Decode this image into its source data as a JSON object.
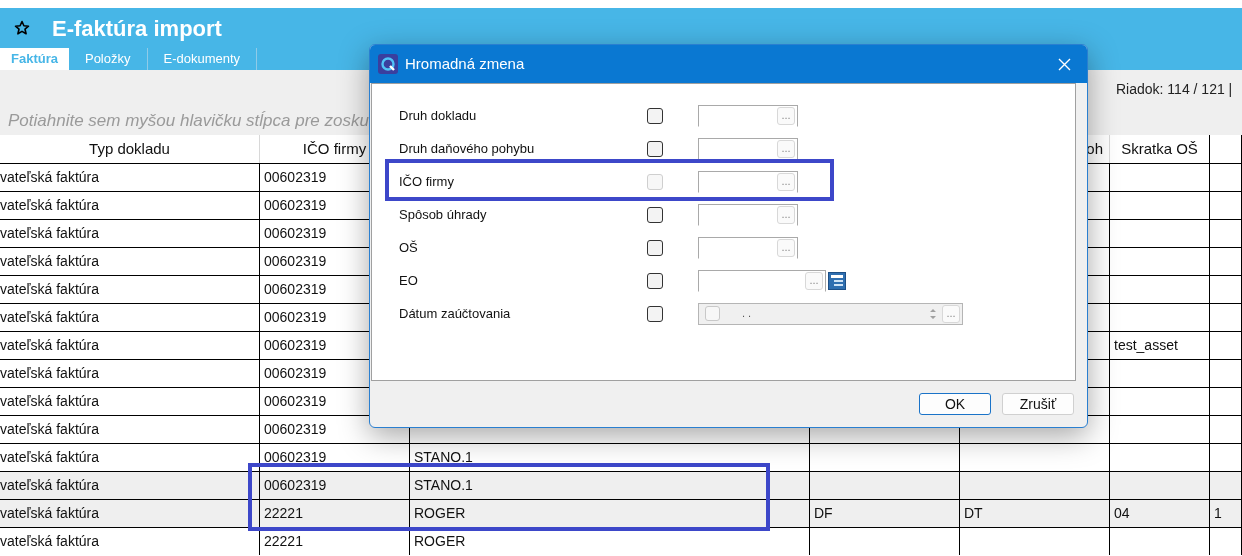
{
  "app": {
    "title": "E-faktúra import"
  },
  "tabs": [
    {
      "label": "Faktúra",
      "selected": true
    },
    {
      "label": "Položky",
      "selected": false
    },
    {
      "label": "E-dokumenty",
      "selected": false
    }
  ],
  "row_counter": "Riadok: 114 / 121 |",
  "group_hint": "Potiahnite sem myšou hlavičku stĺpca pre zosku",
  "table": {
    "header": {
      "column_1": "Typ dokladu",
      "column_2": "IČO firmy",
      "column_5": "oh",
      "column_6": "Skratka OŠ"
    },
    "rows": [
      {
        "cells": {
          "column_1": "vateľská faktúra",
          "column_2": "00602319"
        },
        "shaded": false,
        "outlined": false
      },
      {
        "cells": {
          "column_1": "vateľská faktúra",
          "column_2": "00602319"
        },
        "shaded": false,
        "outlined": false
      },
      {
        "cells": {
          "column_1": "vateľská faktúra",
          "column_2": "00602319"
        },
        "shaded": false,
        "outlined": false
      },
      {
        "cells": {
          "column_1": "vateľská faktúra",
          "column_2": "00602319"
        },
        "shaded": false,
        "outlined": false
      },
      {
        "cells": {
          "column_1": "vateľská faktúra",
          "column_2": "00602319"
        },
        "shaded": false,
        "outlined": false
      },
      {
        "cells": {
          "column_1": "vateľská faktúra",
          "column_2": "00602319"
        },
        "shaded": false,
        "outlined": false
      },
      {
        "cells": {
          "column_1": "vateľská faktúra",
          "column_2": "00602319",
          "column_6": "test_asset"
        },
        "shaded": false,
        "outlined": false
      },
      {
        "cells": {
          "column_1": "vateľská faktúra",
          "column_2": "00602319"
        },
        "shaded": false,
        "outlined": false
      },
      {
        "cells": {
          "column_1": "vateľská faktúra",
          "column_2": "00602319"
        },
        "shaded": false,
        "outlined": false
      },
      {
        "cells": {
          "column_1": "vateľská faktúra",
          "column_2": "00602319"
        },
        "shaded": false,
        "outlined": false
      },
      {
        "cells": {
          "column_1": "vateľská faktúra",
          "column_2": "00602319",
          "column_3": "STANO.1"
        },
        "shaded": false,
        "outlined": false
      },
      {
        "cells": {
          "column_1": "vateľská faktúra",
          "column_2": "00602319",
          "column_3": "STANO.1"
        },
        "shaded": true,
        "outlined": true
      },
      {
        "cells": {
          "column_1": "vateľská faktúra",
          "column_2": "22221",
          "column_3": "ROGER",
          "column_4": "DF",
          "column_5": "DT",
          "column_6": "04",
          "column_7": "1"
        },
        "shaded": true,
        "outlined": true
      },
      {
        "cells": {
          "column_1": "vateľská faktúra",
          "column_2": "22221",
          "column_3": "ROGER"
        },
        "shaded": false,
        "outlined": false
      }
    ]
  },
  "dialog": {
    "title": "Hromadná zmena",
    "fields": [
      {
        "label": "Druh dokladu",
        "kind": "lookup",
        "checked": false,
        "disabled": false,
        "outlined": false,
        "browse": "..."
      },
      {
        "label": "Druh daňového pohybu",
        "kind": "lookup",
        "checked": false,
        "disabled": false,
        "outlined": false,
        "browse": "..."
      },
      {
        "label": "IČO firmy",
        "kind": "lookup",
        "checked": false,
        "disabled": true,
        "outlined": true,
        "browse": "..."
      },
      {
        "label": "Spôsob úhrady",
        "kind": "lookup",
        "checked": false,
        "disabled": false,
        "outlined": false,
        "browse": "..."
      },
      {
        "label": "OŠ",
        "kind": "lookup",
        "checked": false,
        "disabled": false,
        "outlined": false,
        "browse": "..."
      },
      {
        "label": "EO",
        "kind": "lookup_tree",
        "checked": false,
        "disabled": false,
        "outlined": false,
        "browse": "..."
      },
      {
        "label": "Dátum zaúčtovania",
        "kind": "date",
        "checked": false,
        "disabled": false,
        "outlined": false,
        "date_checked": false,
        "mask": ". .",
        "browse": "..."
      }
    ],
    "buttons": [
      {
        "label": "OK",
        "default": true
      },
      {
        "label": "Zrušiť",
        "default": false
      }
    ]
  }
}
